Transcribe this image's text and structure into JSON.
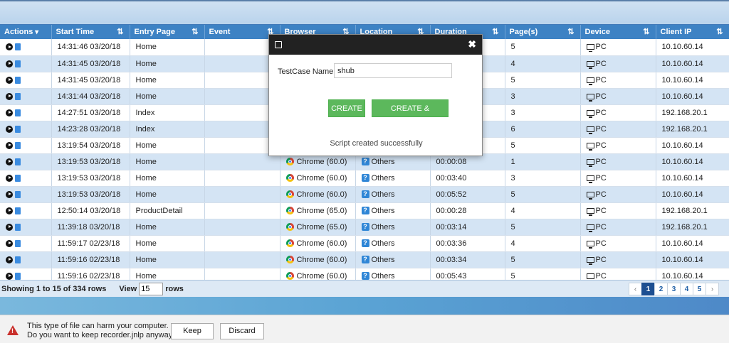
{
  "grid": {
    "columns": [
      {
        "label": "Actions",
        "sort_icon": "caret-down-icon"
      },
      {
        "label": "Start Time",
        "sort_icon": "sort-icon"
      },
      {
        "label": "Entry Page",
        "sort_icon": "sort-icon"
      },
      {
        "label": "Event",
        "sort_icon": "sort-icon"
      },
      {
        "label": "Browser",
        "sort_icon": "sort-icon"
      },
      {
        "label": "Location",
        "sort_icon": "sort-icon"
      },
      {
        "label": "Duration",
        "sort_icon": "sort-icon"
      },
      {
        "label": "Page(s)",
        "sort_icon": "sort-icon"
      },
      {
        "label": "Device",
        "sort_icon": "sort-icon"
      },
      {
        "label": "Client IP",
        "sort_icon": "sort-icon"
      }
    ],
    "rows": [
      {
        "start_time": "14:31:46 03/20/18",
        "entry_page": "Home",
        "event": "",
        "browser": "",
        "location": "",
        "duration": "",
        "pages": "5",
        "device": "PC",
        "client_ip": "10.10.60.14"
      },
      {
        "start_time": "14:31:45 03/20/18",
        "entry_page": "Home",
        "event": "",
        "browser": "",
        "location": "",
        "duration": "",
        "pages": "4",
        "device": "PC",
        "client_ip": "10.10.60.14"
      },
      {
        "start_time": "14:31:45 03/20/18",
        "entry_page": "Home",
        "event": "",
        "browser": "",
        "location": "",
        "duration": "",
        "pages": "5",
        "device": "PC",
        "client_ip": "10.10.60.14"
      },
      {
        "start_time": "14:31:44 03/20/18",
        "entry_page": "Home",
        "event": "",
        "browser": "",
        "location": "",
        "duration": "",
        "pages": "3",
        "device": "PC",
        "client_ip": "10.10.60.14"
      },
      {
        "start_time": "14:27:51 03/20/18",
        "entry_page": "Index",
        "event": "",
        "browser": "",
        "location": "",
        "duration": "",
        "pages": "3",
        "device": "PC",
        "client_ip": "192.168.20.1"
      },
      {
        "start_time": "14:23:28 03/20/18",
        "entry_page": "Index",
        "event": "",
        "browser": "",
        "location": "",
        "duration": "",
        "pages": "6",
        "device": "PC",
        "client_ip": "192.168.20.1"
      },
      {
        "start_time": "13:19:54 03/20/18",
        "entry_page": "Home",
        "event": "",
        "browser": "",
        "location": "",
        "duration": "",
        "pages": "5",
        "device": "PC",
        "client_ip": "10.10.60.14"
      },
      {
        "start_time": "13:19:53 03/20/18",
        "entry_page": "Home",
        "event": "",
        "browser": "Chrome (60.0)",
        "location": "Others",
        "duration": "00:00:08",
        "pages": "1",
        "device": "PC",
        "client_ip": "10.10.60.14"
      },
      {
        "start_time": "13:19:53 03/20/18",
        "entry_page": "Home",
        "event": "",
        "browser": "Chrome (60.0)",
        "location": "Others",
        "duration": "00:03:40",
        "pages": "3",
        "device": "PC",
        "client_ip": "10.10.60.14"
      },
      {
        "start_time": "13:19:53 03/20/18",
        "entry_page": "Home",
        "event": "",
        "browser": "Chrome (60.0)",
        "location": "Others",
        "duration": "00:05:52",
        "pages": "5",
        "device": "PC",
        "client_ip": "10.10.60.14"
      },
      {
        "start_time": "12:50:14 03/20/18",
        "entry_page": "ProductDetail",
        "event": "",
        "browser": "Chrome (65.0)",
        "location": "Others",
        "duration": "00:00:28",
        "pages": "4",
        "device": "PC",
        "client_ip": "192.168.20.1"
      },
      {
        "start_time": "11:39:18 03/20/18",
        "entry_page": "Home",
        "event": "",
        "browser": "Chrome (65.0)",
        "location": "Others",
        "duration": "00:03:14",
        "pages": "5",
        "device": "PC",
        "client_ip": "192.168.20.1"
      },
      {
        "start_time": "11:59:17 02/23/18",
        "entry_page": "Home",
        "event": "",
        "browser": "Chrome (60.0)",
        "location": "Others",
        "duration": "00:03:36",
        "pages": "4",
        "device": "PC",
        "client_ip": "10.10.60.14"
      },
      {
        "start_time": "11:59:16 02/23/18",
        "entry_page": "Home",
        "event": "",
        "browser": "Chrome (60.0)",
        "location": "Others",
        "duration": "00:03:34",
        "pages": "5",
        "device": "PC",
        "client_ip": "10.10.60.14"
      },
      {
        "start_time": "11:59:16 02/23/18",
        "entry_page": "Home",
        "event": "",
        "browser": "Chrome (60.0)",
        "location": "Others",
        "duration": "00:05:43",
        "pages": "5",
        "device": "PC",
        "client_ip": "10.10.60.14"
      }
    ]
  },
  "footer": {
    "showing": "Showing 1 to 15 of 334 rows",
    "view_label": "View",
    "view_value": "15",
    "rows_label": "rows",
    "pager": {
      "prev": "‹",
      "pages": [
        "1",
        "2",
        "3",
        "4",
        "5"
      ],
      "active": "1",
      "next": "›"
    }
  },
  "modal": {
    "label": "TestCase Name",
    "input_value": "shub",
    "create_label": "CREATE",
    "create_execute_label": "CREATE & EXECUTE",
    "status": "Script created successfully",
    "close_glyph": "✖"
  },
  "download_bar": {
    "line1": "This type of file can harm your computer.",
    "line2": "Do you want to keep recorder.jnlp anyway?",
    "keep_label": "Keep",
    "discard_label": "Discard"
  },
  "colors": {
    "header_blue": "#3d82c4",
    "row_alt": "#d4e4f4",
    "green_button": "#5cb85c",
    "pager_active": "#1d4f91"
  }
}
